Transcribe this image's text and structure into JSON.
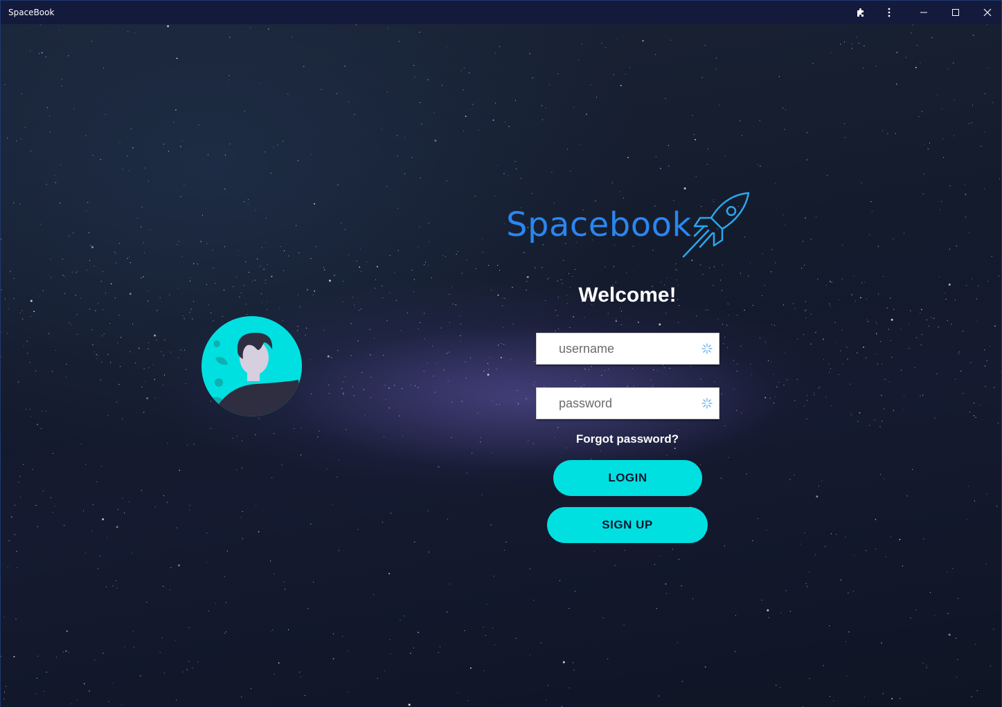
{
  "window": {
    "title": "SpaceBook"
  },
  "titlebar": {
    "buttons": [
      {
        "icon": "puzzle-icon"
      },
      {
        "icon": "more-vertical-icon"
      },
      {
        "icon": "minimize-icon"
      },
      {
        "icon": "maximize-icon"
      },
      {
        "icon": "close-icon"
      }
    ]
  },
  "login": {
    "logo_text": "Spacebook",
    "welcome": "Welcome!",
    "username_placeholder": "username",
    "username_value": "",
    "password_placeholder": "password",
    "password_value": "",
    "forgot_label": "Forgot password?",
    "login_label": "LOGIN",
    "signup_label": "SIGN UP"
  },
  "colors": {
    "accent": "#00e0e0",
    "logo": "#2a86f0",
    "titlebar": "#141a3c",
    "button_text": "#0c1630"
  }
}
